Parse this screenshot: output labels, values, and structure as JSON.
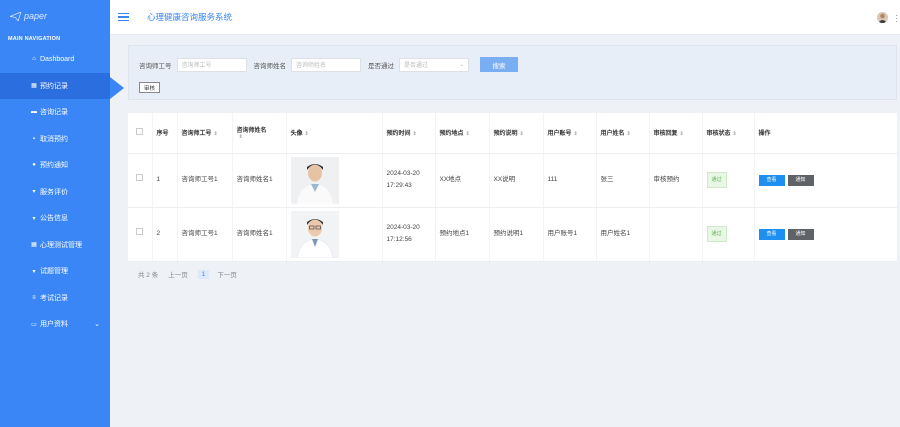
{
  "sidebar": {
    "logo": "paper",
    "nav_header": "MAIN NAVIGATION",
    "items": [
      {
        "label": "Dashboard",
        "icon": "home-icon"
      },
      {
        "label": "预约记录",
        "icon": "grid-icon"
      },
      {
        "label": "咨询记录",
        "icon": "folder-icon"
      },
      {
        "label": "取消预约",
        "icon": "cancel-icon"
      },
      {
        "label": "预约通知",
        "icon": "user-icon"
      },
      {
        "label": "服务评价",
        "icon": "comment-icon"
      },
      {
        "label": "公告信息",
        "icon": "comment-icon"
      },
      {
        "label": "心理测试管理",
        "icon": "grid-icon"
      },
      {
        "label": "试题管理",
        "icon": "comment-icon"
      },
      {
        "label": "考试记录",
        "icon": "list-icon"
      },
      {
        "label": "用户资料",
        "icon": "calendar-icon"
      }
    ]
  },
  "header": {
    "title": "心理健康咨询服务系统"
  },
  "search": {
    "field1_label": "咨询师工号",
    "field1_placeholder": "咨询师工号",
    "field2_label": "咨询师姓名",
    "field2_placeholder": "咨询师姓名",
    "field3_label": "是否通过",
    "field3_placeholder": "是否通过",
    "search_button": "搜索",
    "audit_button": "审核"
  },
  "table": {
    "headers": [
      "序号",
      "咨询师工号",
      "咨询师姓名",
      "头像",
      "预约时间",
      "预约地点",
      "预约说明",
      "用户账号",
      "用户姓名",
      "审核回复",
      "审核状态",
      "操作"
    ],
    "rows": [
      {
        "index": "1",
        "consultant_id": "咨询师工号1",
        "consultant_name": "咨询师姓名1",
        "time": "2024-03-20 17:29:43",
        "place": "XX地点",
        "note": "XX说明",
        "user_account": "111",
        "user_name": "张三",
        "reply": "审核预约",
        "status": "通过"
      },
      {
        "index": "2",
        "consultant_id": "咨询师工号1",
        "consultant_name": "咨询师姓名1",
        "time": "2024-03-20 17:12:56",
        "place": "预约地点1",
        "note": "预约说明1",
        "user_account": "用户账号1",
        "user_name": "用户姓名1",
        "reply": "",
        "status": "通过"
      }
    ],
    "view_button": "查看",
    "notify_button": "通知"
  },
  "pagination": {
    "total": "共 2 条",
    "prev": "上一页",
    "current": "1",
    "next": "下一页"
  },
  "colors": {
    "primary": "#3a86f7",
    "sidebar_active": "#2a6ee0",
    "success": "#58b24a"
  }
}
